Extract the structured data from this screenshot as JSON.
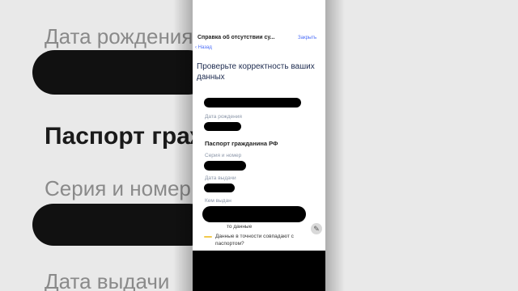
{
  "header": {
    "title": "Справка об отсутствии су...",
    "close_label": "Закрыть",
    "back_label": "Назад"
  },
  "heading": "Проверьте корректность ваших данных",
  "fields": {
    "birth_date_label": "Дата рождения",
    "passport_section": "Паспорт гражданина РФ",
    "series_number_label": "Серия и номер",
    "issue_date_label": "Дата выдачи",
    "issued_by_label": "Кем выдан"
  },
  "footer": {
    "partial_text": "то данные",
    "question": "Данные в точности совпадают с паспортом?"
  },
  "background": {
    "birth_label": "Дата рождения",
    "passport_heading": "Паспорт граж",
    "series_label": "Серия и номер",
    "issue_label": "Дата выдачи"
  },
  "colors": {
    "accent": "#4a6cf7",
    "heading": "#1d2b4f",
    "muted": "#8b96a8",
    "warning": "#f2c94c"
  },
  "icons": {
    "back": "chevron-left-icon",
    "edit": "pencil-icon"
  }
}
